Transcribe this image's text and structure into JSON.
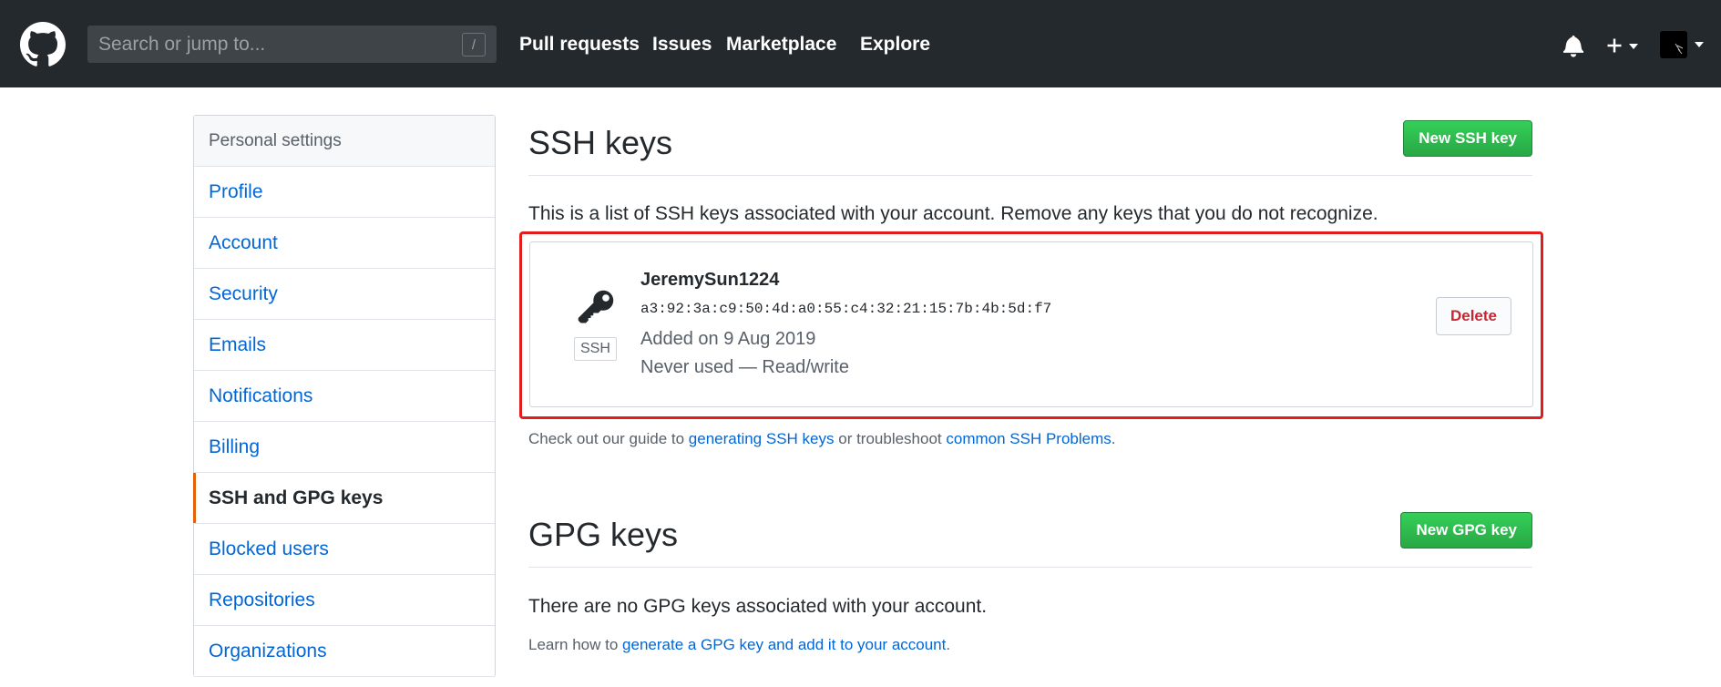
{
  "header": {
    "search_placeholder": "Search or jump to...",
    "search_shortcut": "/",
    "nav": [
      "Pull requests",
      "Issues",
      "Marketplace",
      "Explore"
    ]
  },
  "sidebar": {
    "title": "Personal settings",
    "items": [
      {
        "label": "Profile"
      },
      {
        "label": "Account"
      },
      {
        "label": "Security"
      },
      {
        "label": "Emails"
      },
      {
        "label": "Notifications"
      },
      {
        "label": "Billing"
      },
      {
        "label": "SSH and GPG keys",
        "active": true
      },
      {
        "label": "Blocked users"
      },
      {
        "label": "Repositories"
      },
      {
        "label": "Organizations"
      }
    ]
  },
  "ssh": {
    "title": "SSH keys",
    "new_button": "New SSH key",
    "description": "This is a list of SSH keys associated with your account. Remove any keys that you do not recognize.",
    "key": {
      "badge": "SSH",
      "title": "JeremySun1224",
      "fingerprint": "a3:92:3a:c9:50:4d:a0:55:c4:32:21:15:7b:4b:5d:f7",
      "added": "Added on 9 Aug 2019",
      "usage": "Never used — Read/write",
      "delete_button": "Delete"
    },
    "guide_prefix": "Check out our guide to",
    "guide_link1": "generating SSH keys",
    "guide_middle": "or troubleshoot",
    "guide_link2": "common SSH Problems",
    "guide_suffix": "."
  },
  "gpg": {
    "title": "GPG keys",
    "new_button": "New GPG key",
    "empty_text": "There are no GPG keys associated with your account.",
    "learn_prefix": "Learn how to",
    "learn_link": "generate a GPG key and add it to your account",
    "learn_suffix": "."
  },
  "colors": {
    "header_bg": "#24292e",
    "link": "#0366d6",
    "primary_green": "#28a745",
    "danger": "#cb2431",
    "highlight_box": "#e11d1d",
    "active_marker": "#e36209"
  }
}
